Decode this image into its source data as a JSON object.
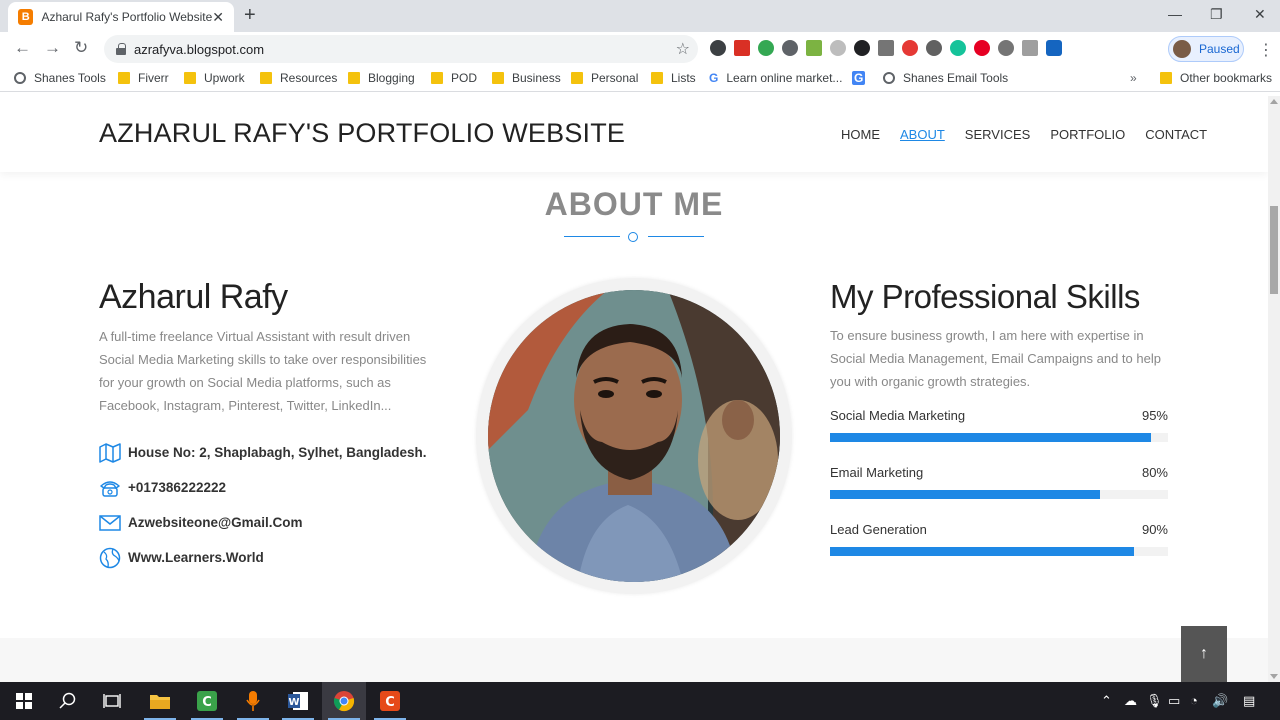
{
  "browser": {
    "tab_title": "Azharul Rafy's Portfolio Website",
    "tab_favicon": "B",
    "url": "azrafyva.blogspot.com",
    "profile_label": "Paused",
    "bookmarks": [
      {
        "label": "Shanes Tools",
        "icon": "globe"
      },
      {
        "label": "Fiverr",
        "icon": "folder"
      },
      {
        "label": "Upwork",
        "icon": "folder"
      },
      {
        "label": "Resources",
        "icon": "folder"
      },
      {
        "label": "Blogging",
        "icon": "folder"
      },
      {
        "label": "POD",
        "icon": "folder"
      },
      {
        "label": "Business",
        "icon": "folder"
      },
      {
        "label": "Personal",
        "icon": "folder"
      },
      {
        "label": "Lists",
        "icon": "folder"
      },
      {
        "label": "Learn online market...",
        "icon": "google"
      },
      {
        "label": "Shanes Email Tools",
        "icon": "globe"
      }
    ],
    "other_bookmarks": "Other bookmarks"
  },
  "site": {
    "title": "AZHARUL RAFY'S PORTFOLIO WEBSITE",
    "nav": [
      {
        "label": "HOME",
        "active": false
      },
      {
        "label": "ABOUT",
        "active": true
      },
      {
        "label": "SERVICES",
        "active": false
      },
      {
        "label": "PORTFOLIO",
        "active": false
      },
      {
        "label": "CONTACT",
        "active": false
      }
    ],
    "accent": "#1e88e5"
  },
  "about": {
    "section_title": "ABOUT ME",
    "name": "Azharul Rafy",
    "bio": "A full-time freelance Virtual Assistant with result driven Social Media Marketing skills to take over responsibilities for your growth on Social Media platforms, such as Facebook, Instagram, Pinterest, Twitter, LinkedIn...",
    "contacts": [
      {
        "icon": "map-icon",
        "text": "House No: 2, Shaplabagh, Sylhet, Bangladesh."
      },
      {
        "icon": "phone-icon",
        "text": "+017386222222"
      },
      {
        "icon": "mail-icon",
        "text": "Azwebsiteone@Gmail.Com"
      },
      {
        "icon": "globe-icon",
        "text": "Www.Learners.World"
      }
    ]
  },
  "skills": {
    "title": "My Professional Skills",
    "description": "To ensure business growth, I am here with expertise in Social Media Management, Email Campaigns and to help you with organic growth strategies.",
    "items": [
      {
        "name": "Social Media Marketing",
        "percent_label": "95%",
        "value": 95
      },
      {
        "name": "Email Marketing",
        "percent_label": "80%",
        "value": 80
      },
      {
        "name": "Lead Generation",
        "percent_label": "90%",
        "value": 90
      }
    ]
  },
  "back_to_top": "↑"
}
